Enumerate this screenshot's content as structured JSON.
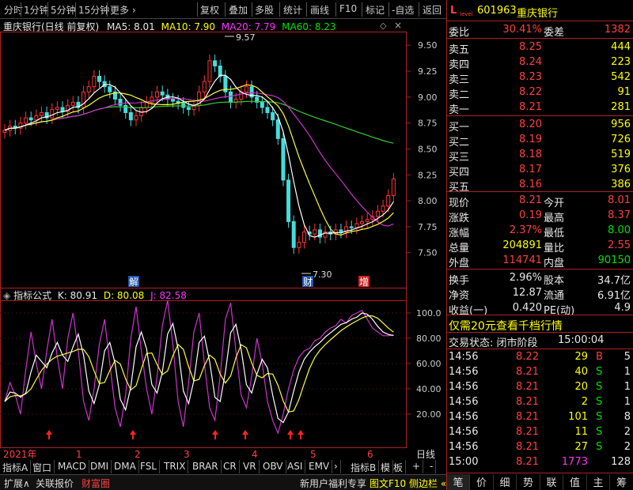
{
  "toolbar": {
    "items": [
      "分时",
      "1分钟",
      "5分钟",
      "15分钟",
      "更多 ›",
      "复权",
      "叠加",
      "多股",
      "统计",
      "画线",
      "F10",
      "标记",
      "-自选",
      "返回"
    ]
  },
  "chart_title": {
    "name": "重庆银行(日线 前复权)",
    "ma5": "MA5: 8.01",
    "ma10": "MA10: 7.90",
    "ma20": "MA20: 7.79",
    "ma60": "MA60: 8.23"
  },
  "ind_title": {
    "name": "指标公式",
    "k": "K: 80.91",
    "d": "D: 80.08",
    "j": "J: 82.58"
  },
  "price_axis": [
    "9.50",
    "9.25",
    "9.00",
    "8.75",
    "8.50",
    "8.25",
    "8.00",
    "7.75",
    "7.50"
  ],
  "ind_axis": [
    "100.0",
    "80.00",
    "60.00",
    "40.00",
    "20.00"
  ],
  "annotations": {
    "high": "9.57",
    "low": "7.30",
    "jie": "解",
    "cai": "财",
    "zeng": "增"
  },
  "time_axis": {
    "year": "2021年",
    "months": [
      "1",
      "2",
      "3",
      "4",
      "5",
      "6"
    ],
    "period": "日线"
  },
  "tabs": [
    "指标A",
    "窗口",
    "MACD",
    "DMI",
    "DMA",
    "FSL",
    "TRIX",
    "BRAR",
    "CR",
    "VR",
    "OBV",
    "ASI",
    "EMV",
    "›",
    "指标B",
    "模",
    "板",
    "+",
    "-"
  ],
  "bottom": {
    "items": [
      "扩展∧",
      "关联报价",
      "财富圈"
    ],
    "news": "新用户福利专享",
    "f10": "图文F10",
    "side": "侧边栏 «"
  },
  "stock": {
    "badge": "L",
    "level": "level",
    "code": "601963",
    "name": "重庆银行"
  },
  "wei": {
    "l1": "委比",
    "v1": "30.41%",
    "l2": "委差",
    "v2": "1382"
  },
  "sell": [
    {
      "l": "卖五",
      "p": "8.25",
      "v": "444"
    },
    {
      "l": "卖四",
      "p": "8.24",
      "v": "223"
    },
    {
      "l": "卖三",
      "p": "8.23",
      "v": "542"
    },
    {
      "l": "卖二",
      "p": "8.22",
      "v": "91"
    },
    {
      "l": "卖一",
      "p": "8.21",
      "v": "281"
    }
  ],
  "buy": [
    {
      "l": "买一",
      "p": "8.20",
      "v": "956"
    },
    {
      "l": "买二",
      "p": "8.19",
      "v": "726"
    },
    {
      "l": "买三",
      "p": "8.18",
      "v": "519"
    },
    {
      "l": "买四",
      "p": "8.17",
      "v": "376"
    },
    {
      "l": "买五",
      "p": "8.16",
      "v": "386"
    }
  ],
  "quote": [
    {
      "l1": "现价",
      "v1": "8.21",
      "l2": "今开",
      "v2": "8.01"
    },
    {
      "l1": "涨跌",
      "v1": "0.19",
      "l2": "最高",
      "v2": "8.37"
    },
    {
      "l1": "涨幅",
      "v1": "2.37%",
      "l2": "最低",
      "v2": "8.00"
    },
    {
      "l1": "总量",
      "v1": "204891",
      "l2": "量比",
      "v2": "2.55"
    },
    {
      "l1": "外盘",
      "v1": "114741",
      "l2": "内盘",
      "v2": "90150"
    }
  ],
  "fund": [
    {
      "l1": "换手",
      "v1": "2.96%",
      "l2": "股本",
      "v2": "34.7亿"
    },
    {
      "l1": "净资",
      "v1": "12.87",
      "l2": "流通",
      "v2": "6.91亿"
    },
    {
      "l1": "收益(一)",
      "v1": "0.420",
      "l2": "PE(动)",
      "v2": "4.9"
    }
  ],
  "promo": "仅需20元查看千档行情",
  "status": {
    "label": "交易状态: 闭市阶段",
    "time": "15:00:04"
  },
  "ticks": [
    {
      "t": "14:56",
      "p": "8.22",
      "v": "29",
      "bs": "B",
      "n": "5"
    },
    {
      "t": "14:56",
      "p": "8.21",
      "v": "40",
      "bs": "S",
      "n": "1"
    },
    {
      "t": "14:56",
      "p": "8.21",
      "v": "20",
      "bs": "S",
      "n": "1"
    },
    {
      "t": "14:56",
      "p": "8.21",
      "v": "2",
      "bs": "S",
      "n": "1"
    },
    {
      "t": "14:56",
      "p": "8.21",
      "v": "101",
      "bs": "S",
      "n": "8"
    },
    {
      "t": "14:56",
      "p": "8.21",
      "v": "11",
      "bs": "S",
      "n": "2"
    },
    {
      "t": "14:56",
      "p": "8.21",
      "v": "27",
      "bs": "S",
      "n": "2"
    },
    {
      "t": "15:00",
      "p": "8.21",
      "v": "1773",
      "bs": "",
      "n": "128"
    }
  ],
  "bottom_tabs": [
    "笔",
    "价",
    "细",
    "势",
    "联",
    "值",
    "主",
    "筹"
  ]
}
